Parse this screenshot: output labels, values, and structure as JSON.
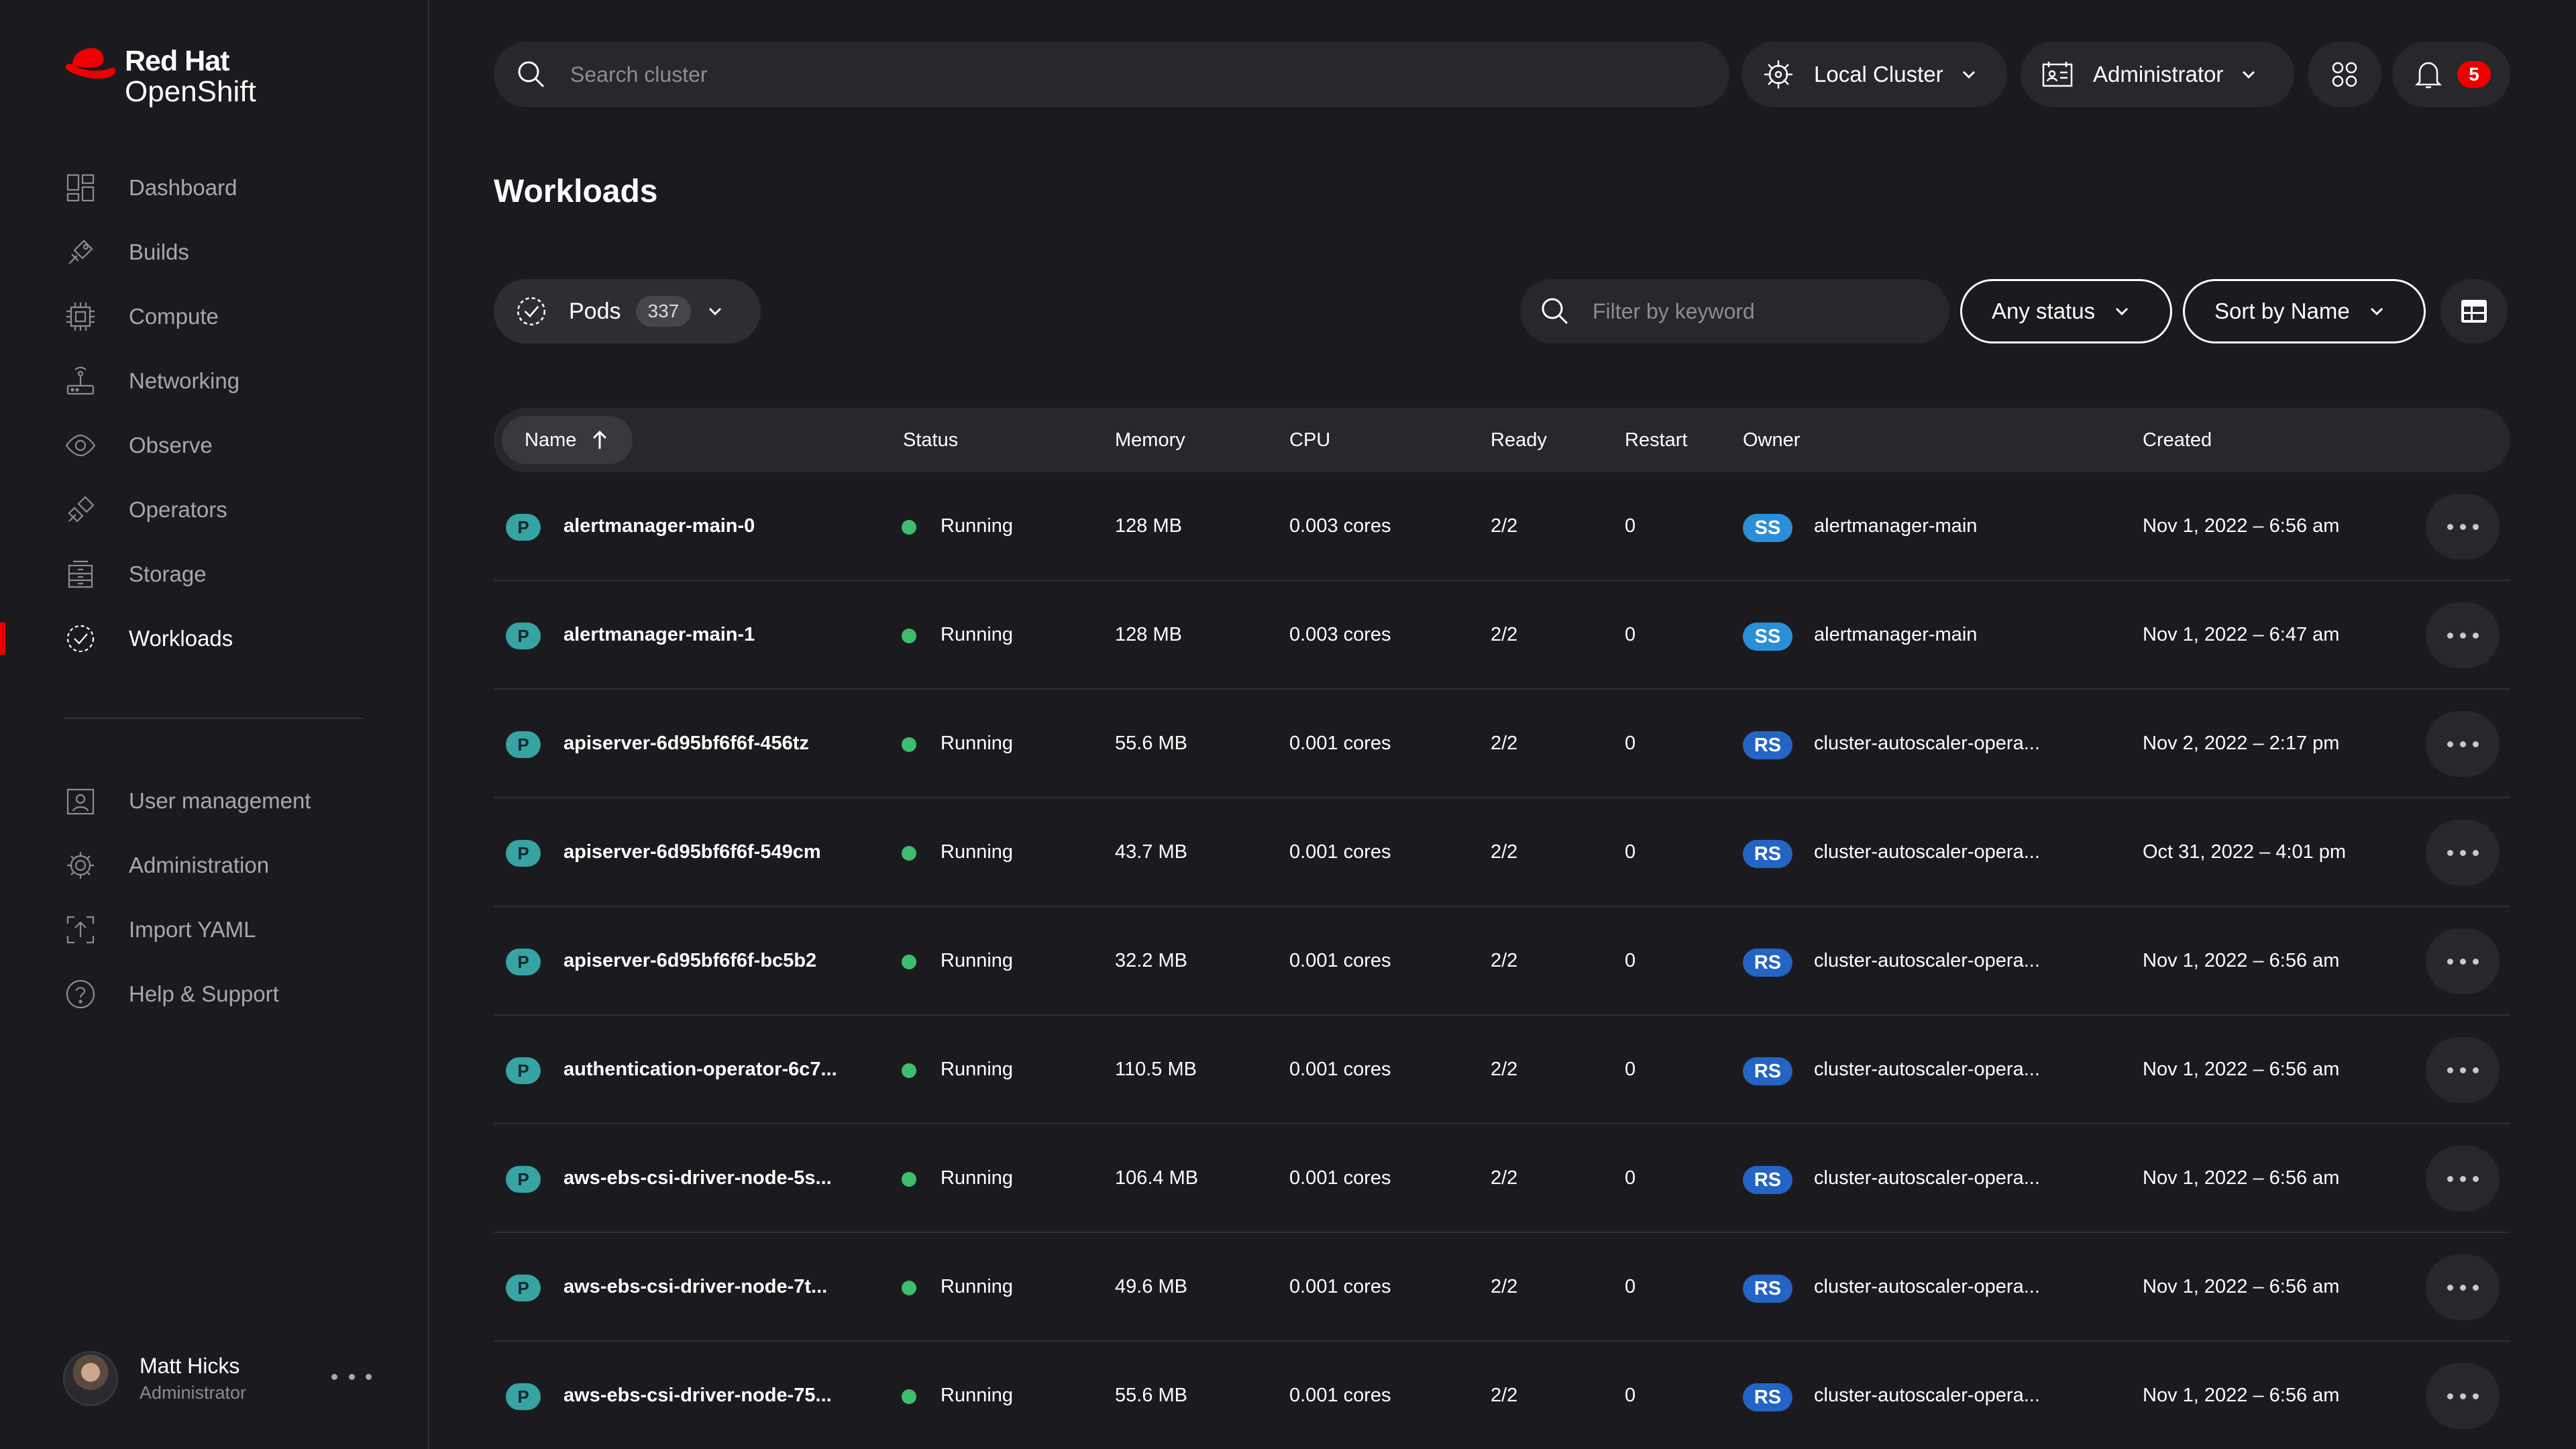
{
  "brand": {
    "line1": "Red Hat",
    "line2": "OpenShift"
  },
  "sidebar": {
    "primary": [
      {
        "label": "Dashboard",
        "icon": "dashboard-icon"
      },
      {
        "label": "Builds",
        "icon": "builds-icon"
      },
      {
        "label": "Compute",
        "icon": "compute-icon"
      },
      {
        "label": "Networking",
        "icon": "networking-icon"
      },
      {
        "label": "Observe",
        "icon": "observe-icon"
      },
      {
        "label": "Operators",
        "icon": "operators-icon"
      },
      {
        "label": "Storage",
        "icon": "storage-icon"
      },
      {
        "label": "Workloads",
        "icon": "workloads-icon",
        "active": true
      }
    ],
    "secondary": [
      {
        "label": "User management",
        "icon": "user-management-icon"
      },
      {
        "label": "Administration",
        "icon": "gear-icon"
      },
      {
        "label": "Import YAML",
        "icon": "import-icon"
      },
      {
        "label": "Help & Support",
        "icon": "help-icon"
      }
    ],
    "user": {
      "name": "Matt Hicks",
      "role": "Administrator"
    }
  },
  "topbar": {
    "search_placeholder": "Search cluster",
    "cluster_label": "Local Cluster",
    "role_label": "Administrator",
    "notification_count": "5"
  },
  "page": {
    "title": "Workloads",
    "resource_label": "Pods",
    "resource_count": "337",
    "filter_placeholder": "Filter by keyword",
    "status_filter": "Any status",
    "sort_label": "Sort by Name"
  },
  "table": {
    "columns": {
      "name": "Name",
      "status": "Status",
      "memory": "Memory",
      "cpu": "CPU",
      "ready": "Ready",
      "restart": "Restart",
      "owner": "Owner",
      "created": "Created"
    },
    "rows": [
      {
        "kind": "P",
        "name": "alertmanager-main-0",
        "status": "Running",
        "memory": "128 MB",
        "cpu": "0.003 cores",
        "ready": "2/2",
        "restart": "0",
        "owner_kind": "SS",
        "owner": "alertmanager-main",
        "created": "Nov 1, 2022 – 6:56 am"
      },
      {
        "kind": "P",
        "name": "alertmanager-main-1",
        "status": "Running",
        "memory": "128 MB",
        "cpu": "0.003 cores",
        "ready": "2/2",
        "restart": "0",
        "owner_kind": "SS",
        "owner": "alertmanager-main",
        "created": "Nov 1, 2022 – 6:47 am"
      },
      {
        "kind": "P",
        "name": "apiserver-6d95bf6f6f-456tz",
        "status": "Running",
        "memory": "55.6 MB",
        "cpu": "0.001 cores",
        "ready": "2/2",
        "restart": "0",
        "owner_kind": "RS",
        "owner": "cluster-autoscaler-opera...",
        "created": "Nov 2, 2022 – 2:17 pm"
      },
      {
        "kind": "P",
        "name": "apiserver-6d95bf6f6f-549cm",
        "status": "Running",
        "memory": "43.7 MB",
        "cpu": "0.001 cores",
        "ready": "2/2",
        "restart": "0",
        "owner_kind": "RS",
        "owner": "cluster-autoscaler-opera...",
        "created": "Oct 31, 2022 – 4:01 pm"
      },
      {
        "kind": "P",
        "name": "apiserver-6d95bf6f6f-bc5b2",
        "status": "Running",
        "memory": "32.2 MB",
        "cpu": "0.001 cores",
        "ready": "2/2",
        "restart": "0",
        "owner_kind": "RS",
        "owner": "cluster-autoscaler-opera...",
        "created": "Nov 1, 2022 – 6:56 am"
      },
      {
        "kind": "P",
        "name": "authentication-operator-6c7...",
        "status": "Running",
        "memory": "110.5 MB",
        "cpu": "0.001 cores",
        "ready": "2/2",
        "restart": "0",
        "owner_kind": "RS",
        "owner": "cluster-autoscaler-opera...",
        "created": "Nov 1, 2022 – 6:56 am"
      },
      {
        "kind": "P",
        "name": "aws-ebs-csi-driver-node-5s...",
        "status": "Running",
        "memory": "106.4 MB",
        "cpu": "0.001 cores",
        "ready": "2/2",
        "restart": "0",
        "owner_kind": "RS",
        "owner": "cluster-autoscaler-opera...",
        "created": "Nov 1, 2022 – 6:56 am"
      },
      {
        "kind": "P",
        "name": "aws-ebs-csi-driver-node-7t...",
        "status": "Running",
        "memory": "49.6 MB",
        "cpu": "0.001 cores",
        "ready": "2/2",
        "restart": "0",
        "owner_kind": "RS",
        "owner": "cluster-autoscaler-opera...",
        "created": "Nov 1, 2022 – 6:56 am"
      },
      {
        "kind": "P",
        "name": "aws-ebs-csi-driver-node-75...",
        "status": "Running",
        "memory": "55.6 MB",
        "cpu": "0.001 cores",
        "ready": "2/2",
        "restart": "0",
        "owner_kind": "RS",
        "owner": "cluster-autoscaler-opera...",
        "created": "Nov 1, 2022 – 6:56 am"
      }
    ]
  },
  "colors": {
    "background": "#1b1b1f",
    "accent": "#ee0000",
    "running": "#3ebd6d",
    "pod_badge": "#37a3a3",
    "ss_badge": "#2b8fd8",
    "rs_badge": "#2464c4"
  }
}
